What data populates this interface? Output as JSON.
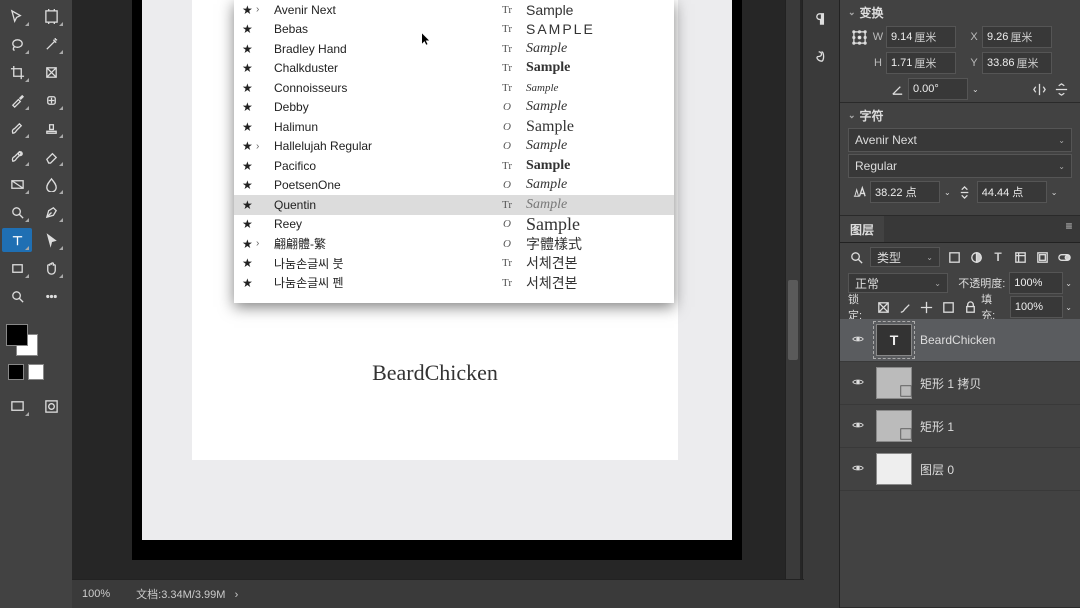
{
  "transform": {
    "title": "变换",
    "w_label": "W",
    "w": "9.14",
    "w_unit": "厘米",
    "x_label": "X",
    "x": "9.26",
    "x_unit": "厘米",
    "h_label": "H",
    "h": "1.71",
    "h_unit": "厘米",
    "y_label": "Y",
    "y": "33.86",
    "y_unit": "厘米",
    "rot": "0.00°"
  },
  "character": {
    "title": "字符",
    "font": "Avenir Next",
    "weight": "Regular",
    "size": "38.22 点",
    "leading": "44.44 点"
  },
  "layers_panel": {
    "title": "图层",
    "filter_kind": "类型",
    "blend": "正常",
    "opacity_label": "不透明度:",
    "opacity": "100%",
    "lock_label": "锁定:",
    "fill_label": "填充:",
    "fill": "100%",
    "layers": [
      {
        "name": "BeardChicken",
        "kind": "text",
        "selected": true
      },
      {
        "name": "矩形 1 拷贝",
        "kind": "shape"
      },
      {
        "name": "矩形 1",
        "kind": "shape"
      },
      {
        "name": "图层 0",
        "kind": "raster"
      }
    ]
  },
  "fonts": [
    {
      "name": "Avenir Next",
      "exp": true,
      "type": "Tr",
      "sample": "Sample",
      "style": "font-family:Helvetica;"
    },
    {
      "name": "Bebas",
      "type": "Tr",
      "sample": "SAMPLE",
      "style": "font-family:Impact,Arial;letter-spacing:2px;"
    },
    {
      "name": "Bradley Hand",
      "type": "Tr",
      "sample": "Sample",
      "style": "font-family:'Comic Sans MS',cursive;font-style:italic;"
    },
    {
      "name": "Chalkduster",
      "type": "Tr",
      "sample": "Sample",
      "style": "font-family:Papyrus,cursive;font-weight:bold;"
    },
    {
      "name": "Connoisseurs",
      "type": "Tr",
      "sample": "Sample",
      "style": "font-family:cursive;font-style:italic;font-size:11px;"
    },
    {
      "name": "Debby",
      "type": "O",
      "sample": "Sample",
      "style": "font-family:cursive;font-style:italic;"
    },
    {
      "name": "Halimun",
      "type": "O",
      "sample": "Sample",
      "style": "font-family:'Brush Script MT',cursive;font-size:16px;"
    },
    {
      "name": "Hallelujah Regular",
      "exp": true,
      "type": "O",
      "sample": "Sample",
      "style": "font-family:cursive;font-style:italic;"
    },
    {
      "name": "Pacifico",
      "type": "Tr",
      "sample": "Sample",
      "style": "font-family:'Brush Script MT',cursive;font-weight:bold;"
    },
    {
      "name": "PoetsenOne",
      "type": "O",
      "sample": "Sample",
      "style": "font-family:Arial Black;font-style:italic;"
    },
    {
      "name": "Quentin",
      "sel": true,
      "type": "Tr",
      "sample": "Sample",
      "style": "font-family:'Brush Script MT',cursive;font-style:italic;color:#777;"
    },
    {
      "name": "Reey",
      "type": "O",
      "sample": "Sample",
      "style": "font-family:'Brush Script MT',cursive;font-size:18px;"
    },
    {
      "name": "翩翩體-繁",
      "exp": true,
      "type": "O",
      "sample": "字體樣式",
      "style": "font-family:KaiTi,cursive;"
    },
    {
      "name": "나눔손글씨 붓",
      "type": "Tr",
      "sample": "서체견본",
      "style": "font-family:sans-serif;"
    },
    {
      "name": "나눔손글씨 펜",
      "type": "Tr",
      "sample": "서체견본",
      "style": "font-family:sans-serif;"
    }
  ],
  "canvas": {
    "caption": "BeardChicken"
  },
  "status": {
    "zoom": "100%",
    "doc_label": "文档:",
    "doc": "3.34M/3.99M"
  },
  "glyph": {
    "chev_right": "›",
    "chev_down": "⌄",
    "dd": "⌄",
    "eye": "◉",
    "star": "★"
  }
}
